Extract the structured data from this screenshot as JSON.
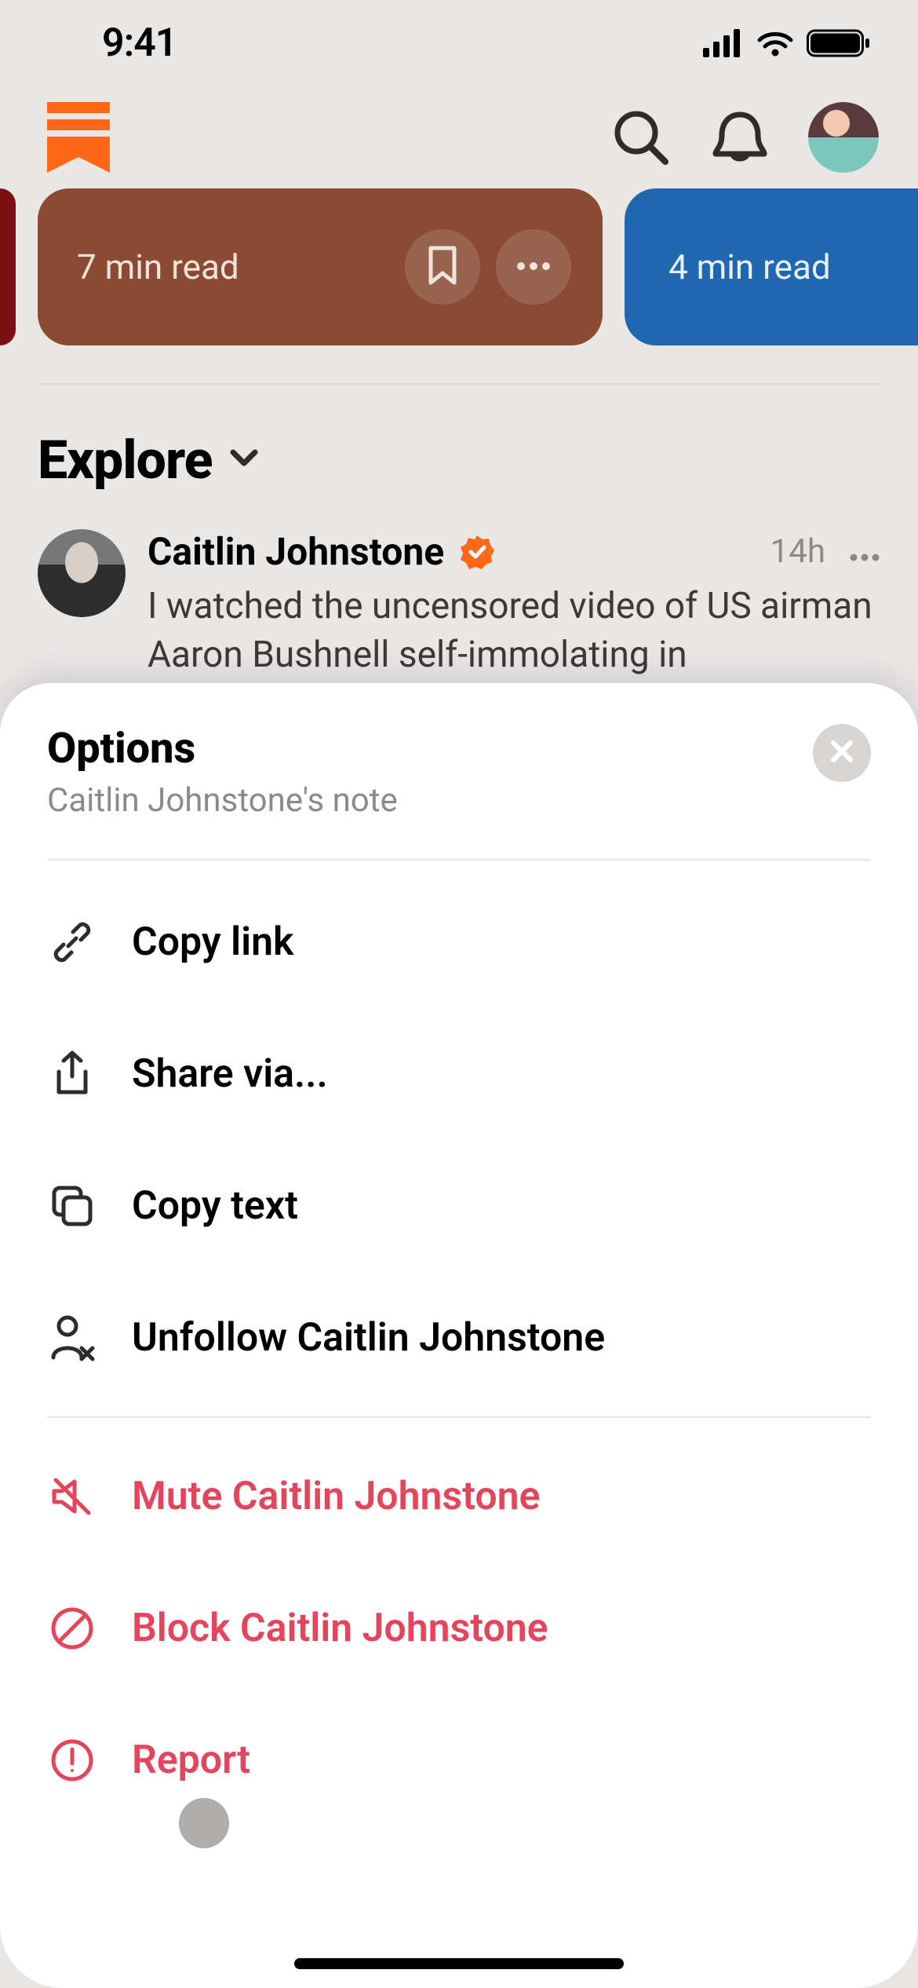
{
  "status": {
    "time": "9:41"
  },
  "cards": [
    {
      "read_time": "7 min read"
    },
    {
      "read_time": "4 min read"
    }
  ],
  "explore": {
    "title": "Explore"
  },
  "post": {
    "author": "Caitlin Johnstone",
    "timestamp": "14h",
    "body": "I watched the uncensored video of US airman Aaron Bushnell self-immolating in"
  },
  "sheet": {
    "title": "Options",
    "subtitle": "Caitlin Johnstone's note",
    "options": [
      {
        "label": "Copy link"
      },
      {
        "label": "Share via..."
      },
      {
        "label": "Copy text"
      },
      {
        "label": "Unfollow Caitlin Johnstone"
      },
      {
        "label": "Mute Caitlin Johnstone"
      },
      {
        "label": "Block Caitlin Johnstone"
      },
      {
        "label": "Report"
      }
    ]
  }
}
